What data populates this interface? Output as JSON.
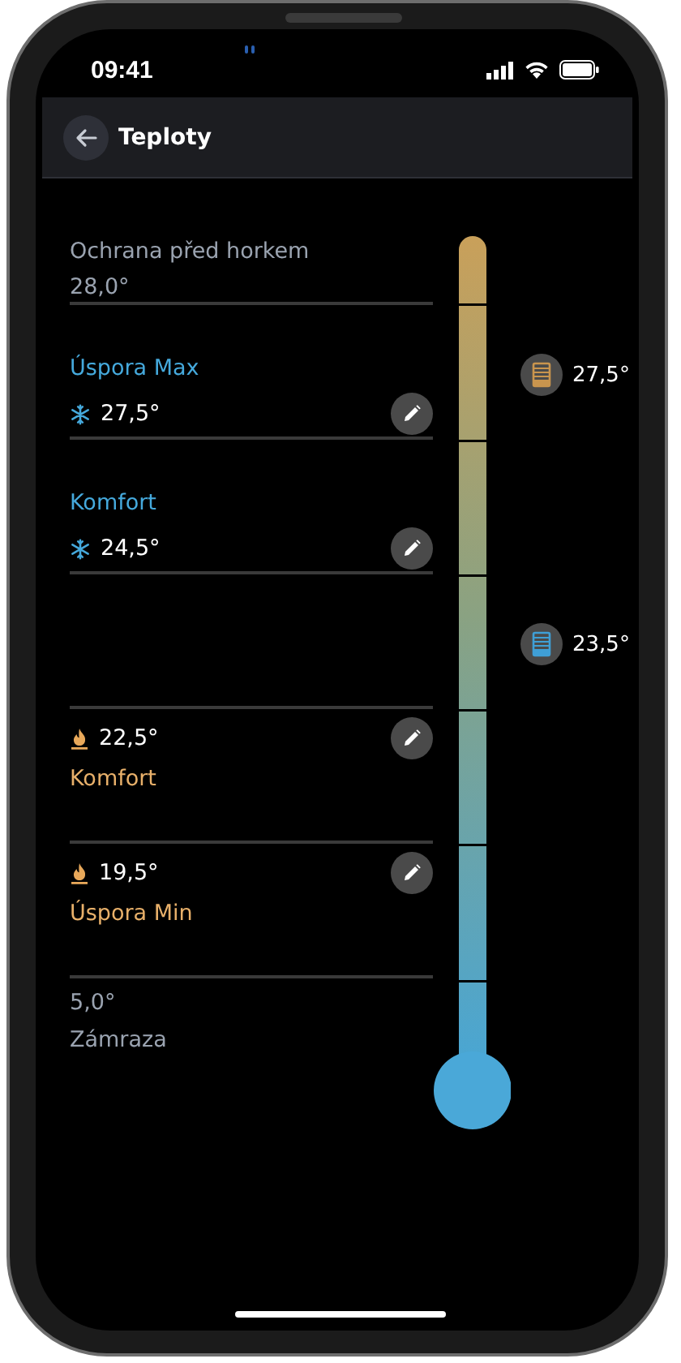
{
  "status_bar": {
    "time": "09:41"
  },
  "header": {
    "title": "Teploty"
  },
  "setpoints": [
    {
      "kind": "upper_limit",
      "label": "Ochrana před horkem",
      "value": "28,0°"
    },
    {
      "kind": "cooling",
      "label": "Úspora Max",
      "value": "27,5°"
    },
    {
      "kind": "cooling",
      "label": "Komfort",
      "value": "24,5°"
    },
    {
      "kind": "heating",
      "label": "Komfort",
      "value": "22,5°"
    },
    {
      "kind": "heating",
      "label": "Úspora Min",
      "value": "19,5°"
    },
    {
      "kind": "lower_limit",
      "label": "Zámraza",
      "value": "5,0°"
    }
  ],
  "indicators": [
    {
      "value": "27,5°",
      "color": "#c9954e"
    },
    {
      "value": "23,5°",
      "color": "#3f9fd6"
    }
  ]
}
